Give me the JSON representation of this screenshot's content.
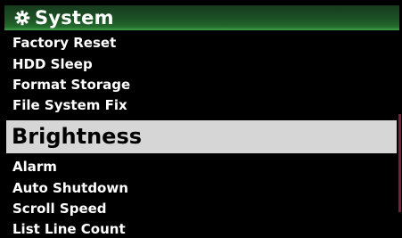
{
  "header": {
    "icon": "gear-icon",
    "title": "System",
    "accent_color": "#226a2c"
  },
  "menu": {
    "items": [
      {
        "label": "Factory Reset",
        "selected": false
      },
      {
        "label": "HDD Sleep",
        "selected": false
      },
      {
        "label": "Format Storage",
        "selected": false
      },
      {
        "label": "File System Fix",
        "selected": false
      },
      {
        "label": "Brightness",
        "selected": true
      },
      {
        "label": "Alarm",
        "selected": false
      },
      {
        "label": "Auto Shutdown",
        "selected": false
      },
      {
        "label": "Scroll Speed",
        "selected": false
      },
      {
        "label": "List Line Count",
        "selected": false
      }
    ],
    "highlight_color": "#d6d6d6",
    "scrollbar_color": "#7a1f3a"
  }
}
